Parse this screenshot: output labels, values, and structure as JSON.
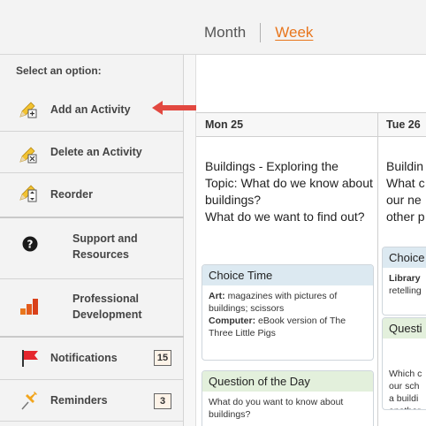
{
  "header": {
    "tab_month": "Month",
    "tab_week": "Week",
    "active_tab": "Week",
    "accent_color": "#e8761d"
  },
  "sidebar": {
    "heading": "Select an option:",
    "items": [
      {
        "label": "Add an Activity",
        "icon": "pencil-plus-icon"
      },
      {
        "label": "Delete an Activity",
        "icon": "pencil-delete-icon"
      },
      {
        "label": "Reorder",
        "icon": "pencil-reorder-icon"
      },
      {
        "label": "Support and\nResources",
        "icon": "question-circle-icon"
      },
      {
        "label": "Professional\nDevelopment",
        "icon": "bar-steps-icon"
      },
      {
        "label": "Notifications",
        "icon": "flag-icon",
        "badge": "15"
      },
      {
        "label": "Reminders",
        "icon": "pushpin-icon",
        "badge": "3"
      }
    ]
  },
  "calendar": {
    "days": [
      {
        "header": "Mon 25",
        "topic": "Buildings - Exploring the Topic: What do we know about buildings?\nWhat do we want to find out?",
        "cards": [
          {
            "title": "Choice Time",
            "lines": [
              {
                "bold": "Art:",
                "text": " magazines with pictures of buildings; scissors"
              },
              {
                "bold": "Computer:",
                "text": " eBook version of The Three Little Pigs"
              }
            ]
          },
          {
            "title": "Question of the Day",
            "lines": [
              {
                "bold": "",
                "text": "What do you want to know about buildings?"
              }
            ]
          }
        ]
      },
      {
        "header": "Tue 26",
        "topic": "Buildin\nWhat c\nour ne\nother p",
        "cards": [
          {
            "title": "Choice",
            "lines": [
              {
                "bold": "Library",
                "text": ""
              },
              {
                "bold": "",
                "text": "retelling"
              }
            ]
          },
          {
            "title": "Questi",
            "lines": [
              {
                "bold": "",
                "text": "Which c\nour sch\na buildi\nanother"
              }
            ]
          }
        ]
      }
    ]
  }
}
